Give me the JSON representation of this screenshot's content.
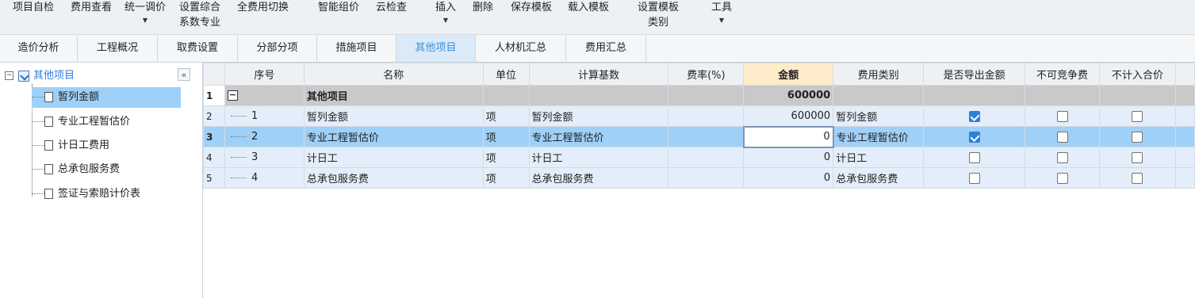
{
  "toolbar": {
    "items": [
      {
        "label": "项目自检"
      },
      {
        "label": "费用查看"
      },
      {
        "label": "统一调价"
      },
      {
        "label": "设置综合",
        "label2": "系数专业"
      },
      {
        "label": "全费用切换"
      },
      {
        "label": "智能组价"
      },
      {
        "label": "云检查"
      },
      {
        "label": "插入"
      },
      {
        "label": "删除"
      },
      {
        "label": "保存模板"
      },
      {
        "label": "载入模板"
      },
      {
        "label": "设置模板",
        "label2": "类别"
      },
      {
        "label": "工具"
      }
    ]
  },
  "tabs": [
    "造价分析",
    "工程概况",
    "取费设置",
    "分部分项",
    "措施项目",
    "其他项目",
    "人材机汇总",
    "费用汇总"
  ],
  "tree": {
    "root": "其他项目",
    "collapse_glyph": "«",
    "nodes": [
      "暂列金额",
      "专业工程暂估价",
      "计日工费用",
      "总承包服务费",
      "签证与索赔计价表"
    ]
  },
  "grid": {
    "columns": [
      "序号",
      "名称",
      "单位",
      "计算基数",
      "费率(%)",
      "金额",
      "费用类别",
      "是否导出金额",
      "不可竞争费",
      "不计入合价"
    ],
    "group_row": {
      "rownum": "1",
      "name": "其他项目",
      "amount": "600000"
    },
    "rows": [
      {
        "rownum": "2",
        "seq": "1",
        "name": "暂列金额",
        "unit": "项",
        "base": "暂列金额",
        "rate": "",
        "amount": "600000",
        "category": "暂列金额",
        "export": true,
        "noncompete": false,
        "exclude": false
      },
      {
        "rownum": "3",
        "seq": "2",
        "name": "专业工程暂估价",
        "unit": "项",
        "base": "专业工程暂估价",
        "rate": "",
        "amount": "0",
        "category": "专业工程暂估价",
        "export": true,
        "noncompete": false,
        "exclude": false
      },
      {
        "rownum": "4",
        "seq": "3",
        "name": "计日工",
        "unit": "项",
        "base": "计日工",
        "rate": "",
        "amount": "0",
        "category": "计日工",
        "export": false,
        "noncompete": false,
        "exclude": false
      },
      {
        "rownum": "5",
        "seq": "4",
        "name": "总承包服务费",
        "unit": "项",
        "base": "总承包服务费",
        "rate": "",
        "amount": "0",
        "category": "总承包服务费",
        "export": false,
        "noncompete": false,
        "exclude": false
      }
    ]
  },
  "colors": {
    "accent": "#2f7ed8",
    "selected_row": "#9fd0f8",
    "group_row": "#c9c9c9",
    "data_row": "#e4eefa"
  }
}
